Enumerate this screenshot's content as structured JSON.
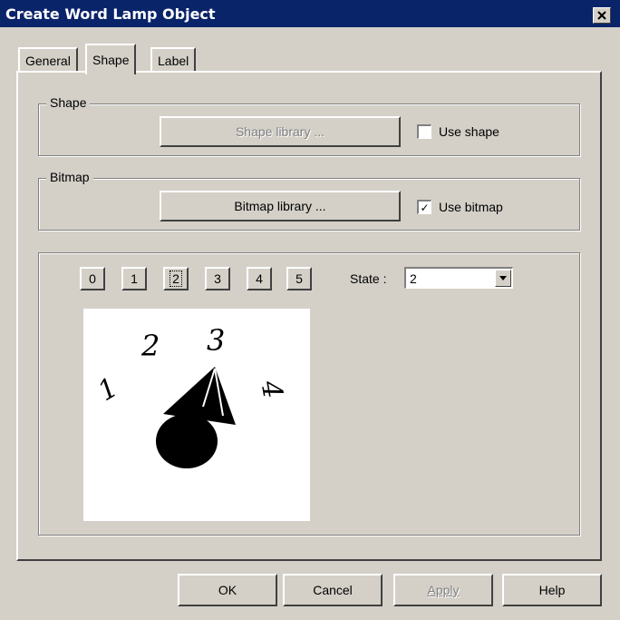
{
  "window": {
    "title": "Create Word Lamp  Object"
  },
  "tabs": [
    {
      "label": "General"
    },
    {
      "label": "Shape"
    },
    {
      "label": "Label"
    }
  ],
  "shape_group": {
    "label": "Shape",
    "library_button": "Shape  library ...",
    "checkbox_label": "Use shape",
    "checked": false
  },
  "bitmap_group": {
    "label": "Bitmap",
    "library_button": "Bitmap  library ...",
    "checkbox_label": "Use bitmap",
    "checked": true,
    "check_mark": "✓"
  },
  "states": {
    "buttons": [
      "0",
      "1",
      "2",
      "3",
      "4",
      "5"
    ],
    "selected": "2",
    "state_label": "State :",
    "state_value": "2"
  },
  "preview": {
    "digits": [
      "1",
      "2",
      "3",
      "4"
    ]
  },
  "footer": {
    "ok": "OK",
    "cancel": "Cancel",
    "apply": "Apply",
    "help": "Help"
  }
}
